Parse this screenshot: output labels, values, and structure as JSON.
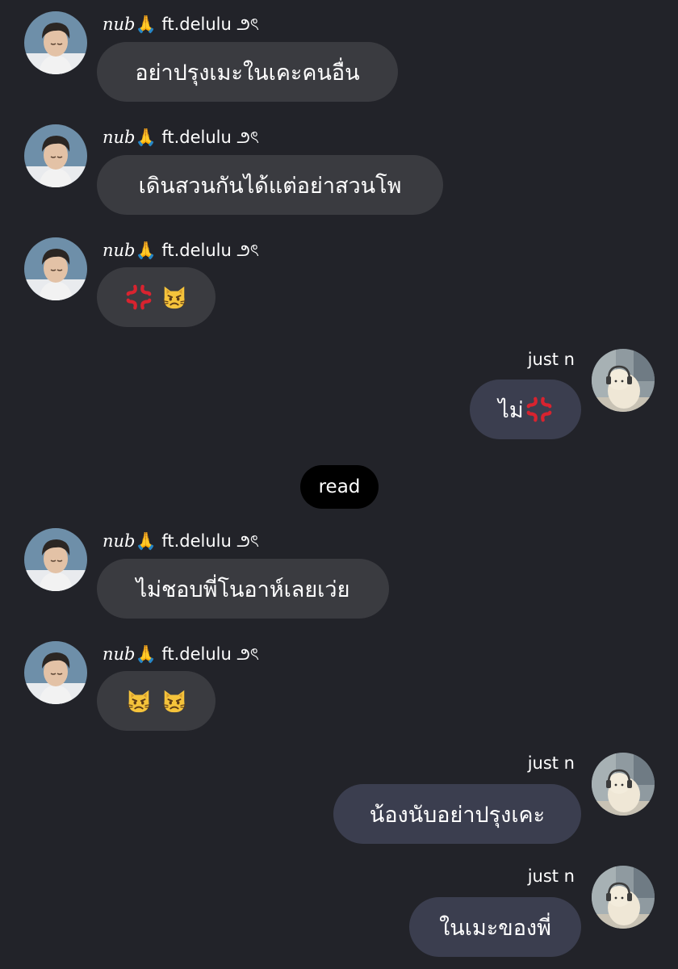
{
  "incoming_name": "nub🙏 ft.delulu ౨ৎ",
  "incoming_name_italic": "nub",
  "incoming_name_rest": "ft.delulu ౨ৎ",
  "outgoing_name": "just n",
  "read_label": "read",
  "emoji": {
    "anger": "anger-symbol",
    "pouting_cat": "pouting-cat-face"
  },
  "messages": [
    {
      "side": "in",
      "text": "อย่าปรุงเมะในเคะคนอื่น"
    },
    {
      "side": "in",
      "text": "เดินสวนกันได้แต่อย่าสวนโพ"
    },
    {
      "side": "in",
      "emojis": [
        "anger-symbol",
        "pouting-cat-face"
      ]
    },
    {
      "side": "out",
      "text": "ไม่",
      "emojis": [
        "anger-symbol"
      ]
    },
    {
      "side": "in",
      "text": "ไม่ชอบพี่โนอาห์เลยเว่ย"
    },
    {
      "side": "in",
      "emojis": [
        "pouting-cat-face",
        "pouting-cat-face"
      ]
    },
    {
      "side": "out",
      "text": "น้องนับอย่าปรุงเคะ"
    },
    {
      "side": "out",
      "text": "ในเมะของพี่"
    }
  ],
  "colors": {
    "background": "#222329",
    "incoming_bubble": "#3a3b40",
    "outgoing_bubble": "#3b3e4f",
    "read_pill": "#000000"
  }
}
